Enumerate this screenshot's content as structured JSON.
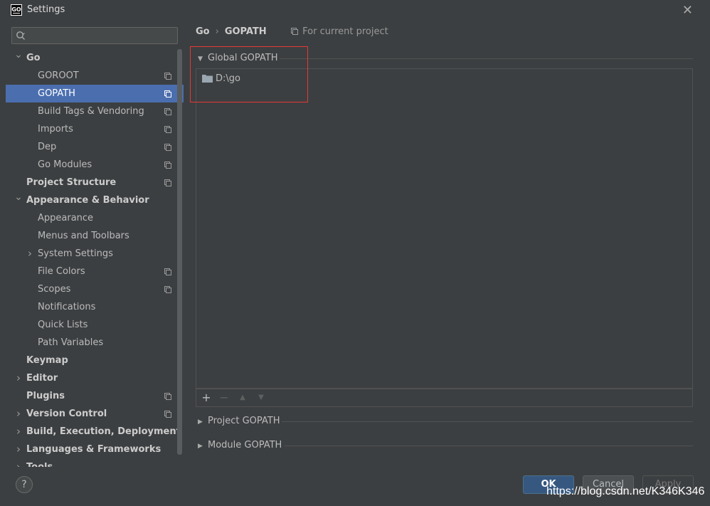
{
  "window": {
    "title": "Settings",
    "app_icon_text": "GO"
  },
  "search": {
    "placeholder": "",
    "value": ""
  },
  "sidebar": {
    "items": [
      {
        "label": "Go",
        "level": 0,
        "bold": true,
        "chevron": "down",
        "project_icon": false,
        "selected": false
      },
      {
        "label": "GOROOT",
        "level": 1,
        "bold": false,
        "chevron": "",
        "project_icon": true,
        "selected": false
      },
      {
        "label": "GOPATH",
        "level": 1,
        "bold": false,
        "chevron": "",
        "project_icon": true,
        "selected": true
      },
      {
        "label": "Build Tags & Vendoring",
        "level": 1,
        "bold": false,
        "chevron": "",
        "project_icon": true,
        "selected": false
      },
      {
        "label": "Imports",
        "level": 1,
        "bold": false,
        "chevron": "",
        "project_icon": true,
        "selected": false
      },
      {
        "label": "Dep",
        "level": 1,
        "bold": false,
        "chevron": "",
        "project_icon": true,
        "selected": false
      },
      {
        "label": "Go Modules",
        "level": 1,
        "bold": false,
        "chevron": "",
        "project_icon": true,
        "selected": false
      },
      {
        "label": "Project Structure",
        "level": 0,
        "bold": true,
        "chevron": "",
        "project_icon": true,
        "selected": false
      },
      {
        "label": "Appearance & Behavior",
        "level": 0,
        "bold": true,
        "chevron": "down",
        "project_icon": false,
        "selected": false
      },
      {
        "label": "Appearance",
        "level": 1,
        "bold": false,
        "chevron": "",
        "project_icon": false,
        "selected": false
      },
      {
        "label": "Menus and Toolbars",
        "level": 1,
        "bold": false,
        "chevron": "",
        "project_icon": false,
        "selected": false
      },
      {
        "label": "System Settings",
        "level": 1,
        "bold": false,
        "chevron": "right",
        "project_icon": false,
        "selected": false
      },
      {
        "label": "File Colors",
        "level": 1,
        "bold": false,
        "chevron": "",
        "project_icon": true,
        "selected": false
      },
      {
        "label": "Scopes",
        "level": 1,
        "bold": false,
        "chevron": "",
        "project_icon": true,
        "selected": false
      },
      {
        "label": "Notifications",
        "level": 1,
        "bold": false,
        "chevron": "",
        "project_icon": false,
        "selected": false
      },
      {
        "label": "Quick Lists",
        "level": 1,
        "bold": false,
        "chevron": "",
        "project_icon": false,
        "selected": false
      },
      {
        "label": "Path Variables",
        "level": 1,
        "bold": false,
        "chevron": "",
        "project_icon": false,
        "selected": false
      },
      {
        "label": "Keymap",
        "level": 0,
        "bold": true,
        "chevron": "",
        "project_icon": false,
        "selected": false
      },
      {
        "label": "Editor",
        "level": 0,
        "bold": true,
        "chevron": "right",
        "project_icon": false,
        "selected": false
      },
      {
        "label": "Plugins",
        "level": 0,
        "bold": true,
        "chevron": "",
        "project_icon": true,
        "selected": false
      },
      {
        "label": "Version Control",
        "level": 0,
        "bold": true,
        "chevron": "right",
        "project_icon": true,
        "selected": false
      },
      {
        "label": "Build, Execution, Deployment",
        "level": 0,
        "bold": true,
        "chevron": "right",
        "project_icon": false,
        "selected": false
      },
      {
        "label": "Languages & Frameworks",
        "level": 0,
        "bold": true,
        "chevron": "right",
        "project_icon": false,
        "selected": false
      },
      {
        "label": "Tools",
        "level": 0,
        "bold": true,
        "chevron": "right",
        "project_icon": false,
        "selected": false
      }
    ]
  },
  "breadcrumb": {
    "parent": "Go",
    "separator": "›",
    "current": "GOPATH"
  },
  "scope_hint": "For current project",
  "sections": {
    "global": {
      "label": "Global GOPATH",
      "expanded": true,
      "paths": [
        "D:\\go"
      ]
    },
    "project": {
      "label": "Project GOPATH",
      "expanded": false
    },
    "module": {
      "label": "Module GOPATH",
      "expanded": false
    }
  },
  "toolbar": {
    "add": "+",
    "remove": "−",
    "up": "▲",
    "down": "▼"
  },
  "buttons": {
    "help": "?",
    "ok": "OK",
    "cancel": "Cancel",
    "apply": "Apply"
  },
  "watermark": "https://blog.csdn.net/K346K346",
  "colors": {
    "selection": "#4b6eaf",
    "highlight_box": "#e53935",
    "ok_button": "#365880"
  }
}
